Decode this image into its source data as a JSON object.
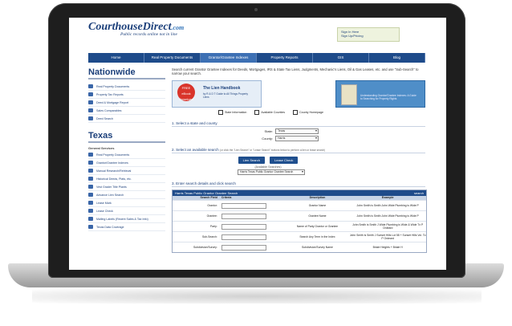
{
  "site": {
    "logo": "CourthouseDirect",
    "logo_suffix": ".com",
    "tagline": "Public records online not in line",
    "login_links": [
      "Sign In Here",
      "Sign Up/Pricing"
    ]
  },
  "nav": {
    "items": [
      "Home",
      "Real Property Documents",
      "Grantor/Grantee Indexes",
      "Property Reports",
      "GIS",
      "Blog"
    ],
    "active_index": 2
  },
  "sidebar": {
    "nationwide_title": "Nationwide",
    "nationwide_items": [
      "Real Property Documents",
      "Property Tax Reports",
      "Deed & Mortgage Report",
      "Sales Comparables",
      "Deed Search"
    ],
    "texas_title": "Texas",
    "texas_subtitle": "General Services",
    "texas_items": [
      "Real Property Documents",
      "Grantor/Grantee Indexes",
      "Manual Research/Retrieval",
      "Historical Deeds, Plats, etc.",
      "Vest Grader Title Plants",
      "Advance Lien Search",
      "Lease Mark",
      "Lease Check",
      "Mailing Labels (Recent Sales & Tax Info)",
      "Texas Data Coverage"
    ]
  },
  "main": {
    "intro": "Search current Grantor Grantee Indexes for Deeds, Mortgages, IRS & State Tax Liens, Judgments, Mechanic's Liens, Oil & Gas Leases, etc. and use \"Sub-Search\" to narrow your search.",
    "banner_left": {
      "badge": "FREE eBook Download",
      "title": "The Lien Handbook",
      "subtitle": "by R & D T Guide to All Things Property Liens"
    },
    "banner_right": {
      "title": "",
      "subtitle": "Understanding Grantor/Grantee Indexes: A Guide to Searching for Property Rights"
    },
    "legend": [
      "State Information",
      "Available Counties",
      "County Homepage"
    ],
    "step1": "1. Select a state and county",
    "state_label": "State:",
    "state_value": "Texas",
    "county_label": "County:",
    "county_value": "Harris",
    "step2": "2. Select an available search",
    "step2_hint": "(or click the \"Lien Search\" or \"Lease Search\" buttons below to perform a lien or lease search)",
    "lien_button": "Lien Search",
    "lease_button": "Lease Check",
    "available_label": "(Available Searches)",
    "available_value": "Harris Texas Public Grantor Grantee Search",
    "step3": "3. Enter search details and click search",
    "table_title": "Harris Texas Public Grantor Grantee Search",
    "table_search": "search",
    "table_headers": [
      "Search Field",
      "Criteria",
      "Description",
      "Example"
    ],
    "table_rows": [
      {
        "field": "Grantor:",
        "desc": "Grantor Name",
        "example": "John Smith is Smith John Wide Plumbing is Wide P"
      },
      {
        "field": "Grantee:",
        "desc": "Grantee Name",
        "example": "John Smith is Smith John Wide Plumbing is Wide P"
      },
      {
        "field": "Party:",
        "desc": "Name of Party Grantor or Grantee",
        "example": "John Smith is Smith J Wide Plumbing is Wide & Wide Tx P Ordeard"
      },
      {
        "field": "Sub-Search:",
        "desc": "Search Any Term in the Index",
        "example": "John Smith is Smith J Sunset Hills Lot 58 + Sunset Hills Vol. To P Ordeard"
      },
      {
        "field": "Subdivision/Survey:",
        "desc": "Subdivision/Survey Name",
        "example": "Briale Heights + Briale H"
      }
    ]
  }
}
